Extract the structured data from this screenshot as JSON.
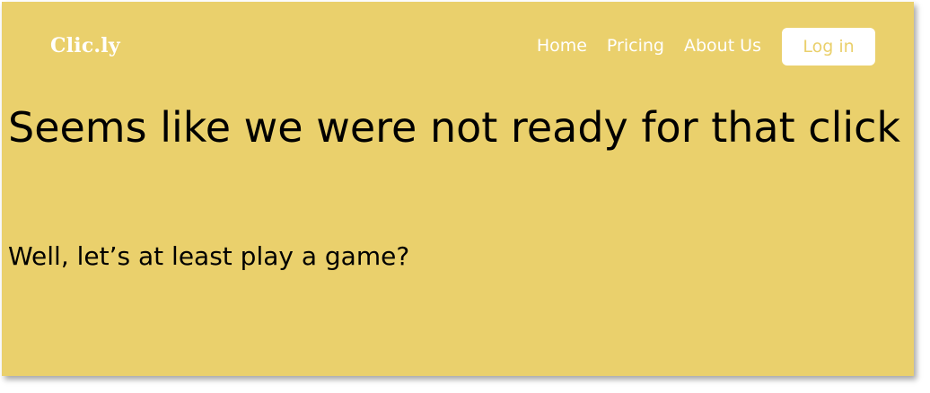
{
  "brand": {
    "name": "Clic.ly"
  },
  "nav": {
    "links": [
      {
        "label": "Home"
      },
      {
        "label": "Pricing"
      },
      {
        "label": "About Us"
      }
    ],
    "login_label": "Log in"
  },
  "main": {
    "headline": "Seems like we were not ready for that click",
    "subheadline": "Well, let’s at least play a game?"
  },
  "colors": {
    "background": "#EAD06C",
    "nav_text": "#FFFFFF",
    "login_button_bg": "#FFFFFF",
    "login_button_text": "#EAD06C",
    "body_text": "#000000"
  }
}
